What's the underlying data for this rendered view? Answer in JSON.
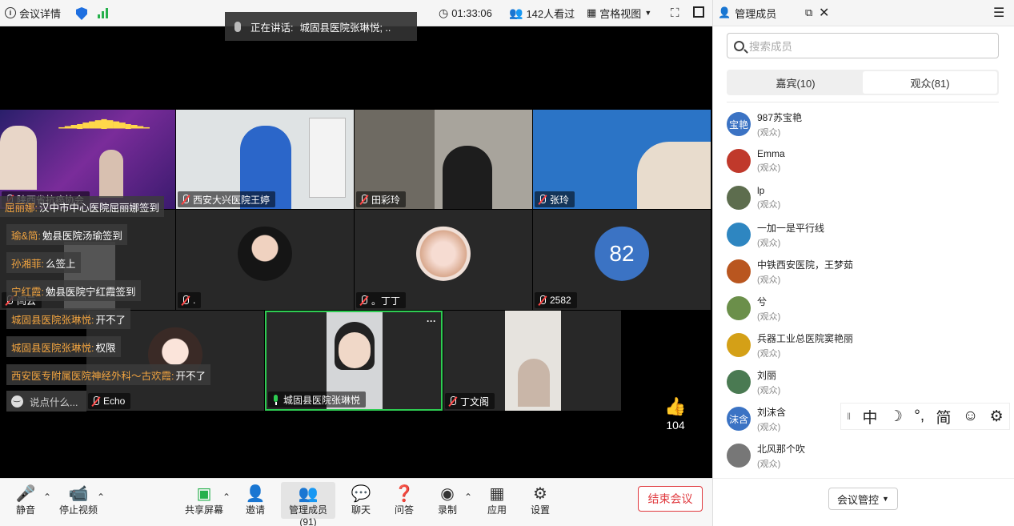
{
  "topbar": {
    "meeting_details": "会议详情",
    "timer": "01:33:06",
    "viewers": "142人看过",
    "view_mode": "宫格视图"
  },
  "speaking": {
    "label": "正在讲话:",
    "name": "城固县医院张琳悦; .."
  },
  "tiles": {
    "t1": "陕西省抗癌协会",
    "t2": "西安大兴医院王婷",
    "t3": "田彩玲",
    "t4": "张玲",
    "t5": "闫云",
    "t6": ".",
    "t7": "。丁丁",
    "t8": "2582",
    "t8_avatar": "82",
    "t9": "Echo",
    "t10": "城固县医院张琳悦",
    "t11": "丁文阁"
  },
  "chat": [
    {
      "name": "屈丽娜:",
      "text": "汉中市中心医院屈丽娜签到"
    },
    {
      "name": "瑜&简:",
      "text": "勉县医院汤瑜签到"
    },
    {
      "name": "孙湘菲:",
      "text": "么签上"
    },
    {
      "name": "宁红霞:",
      "text": "勉县医院宁红霞签到"
    },
    {
      "name": "城固县医院张琳悦:",
      "text": "开不了"
    },
    {
      "name": "城固县医院张琳悦:",
      "text": "权限"
    },
    {
      "name": "西安医专附属医院神经外科～古欢霞:",
      "text": "开不了"
    }
  ],
  "chat_placeholder": "说点什么...",
  "likes": "104",
  "toolbar": {
    "mute": "静音",
    "stop_video": "停止视频",
    "share": "共享屏幕",
    "invite": "邀请",
    "members": "管理成员(91)",
    "chat": "聊天",
    "qa": "问答",
    "record": "录制",
    "apps": "应用",
    "settings": "设置",
    "end": "结束会议"
  },
  "panel": {
    "title": "管理成员",
    "search_placeholder": "搜索成员",
    "tab_guests": "嘉宾(10)",
    "tab_audience": "观众(81)",
    "members": [
      {
        "name": "987苏宝艳",
        "role": "(观众)",
        "avatar": "宝艳",
        "color": "#3b73c4"
      },
      {
        "name": "Emma",
        "role": "(观众)",
        "avatar": "",
        "color": "#c0392b"
      },
      {
        "name": "lp",
        "role": "(观众)",
        "avatar": "",
        "color": "#5d6d4e"
      },
      {
        "name": "一加一是平行线",
        "role": "(观众)",
        "avatar": "",
        "color": "#2e86c1"
      },
      {
        "name": "中铁西安医院，王梦茹",
        "role": "(观众)",
        "avatar": "",
        "color": "#b9561f"
      },
      {
        "name": "兮",
        "role": "(观众)",
        "avatar": "",
        "color": "#6b8f4a"
      },
      {
        "name": "兵器工业总医院窦艳丽",
        "role": "(观众)",
        "avatar": "",
        "color": "#d4a017"
      },
      {
        "name": "刘丽",
        "role": "(观众)",
        "avatar": "",
        "color": "#4a7a52"
      },
      {
        "name": "刘沫含",
        "role": "(观众)",
        "avatar": "沫含",
        "color": "#3b73c4"
      },
      {
        "name": "北风那个吹",
        "role": "(观众)",
        "avatar": "",
        "color": "#777777"
      }
    ],
    "control": "会议管控"
  },
  "ime": [
    "中",
    "☽",
    "°,",
    "简",
    "☺",
    "⚙"
  ]
}
